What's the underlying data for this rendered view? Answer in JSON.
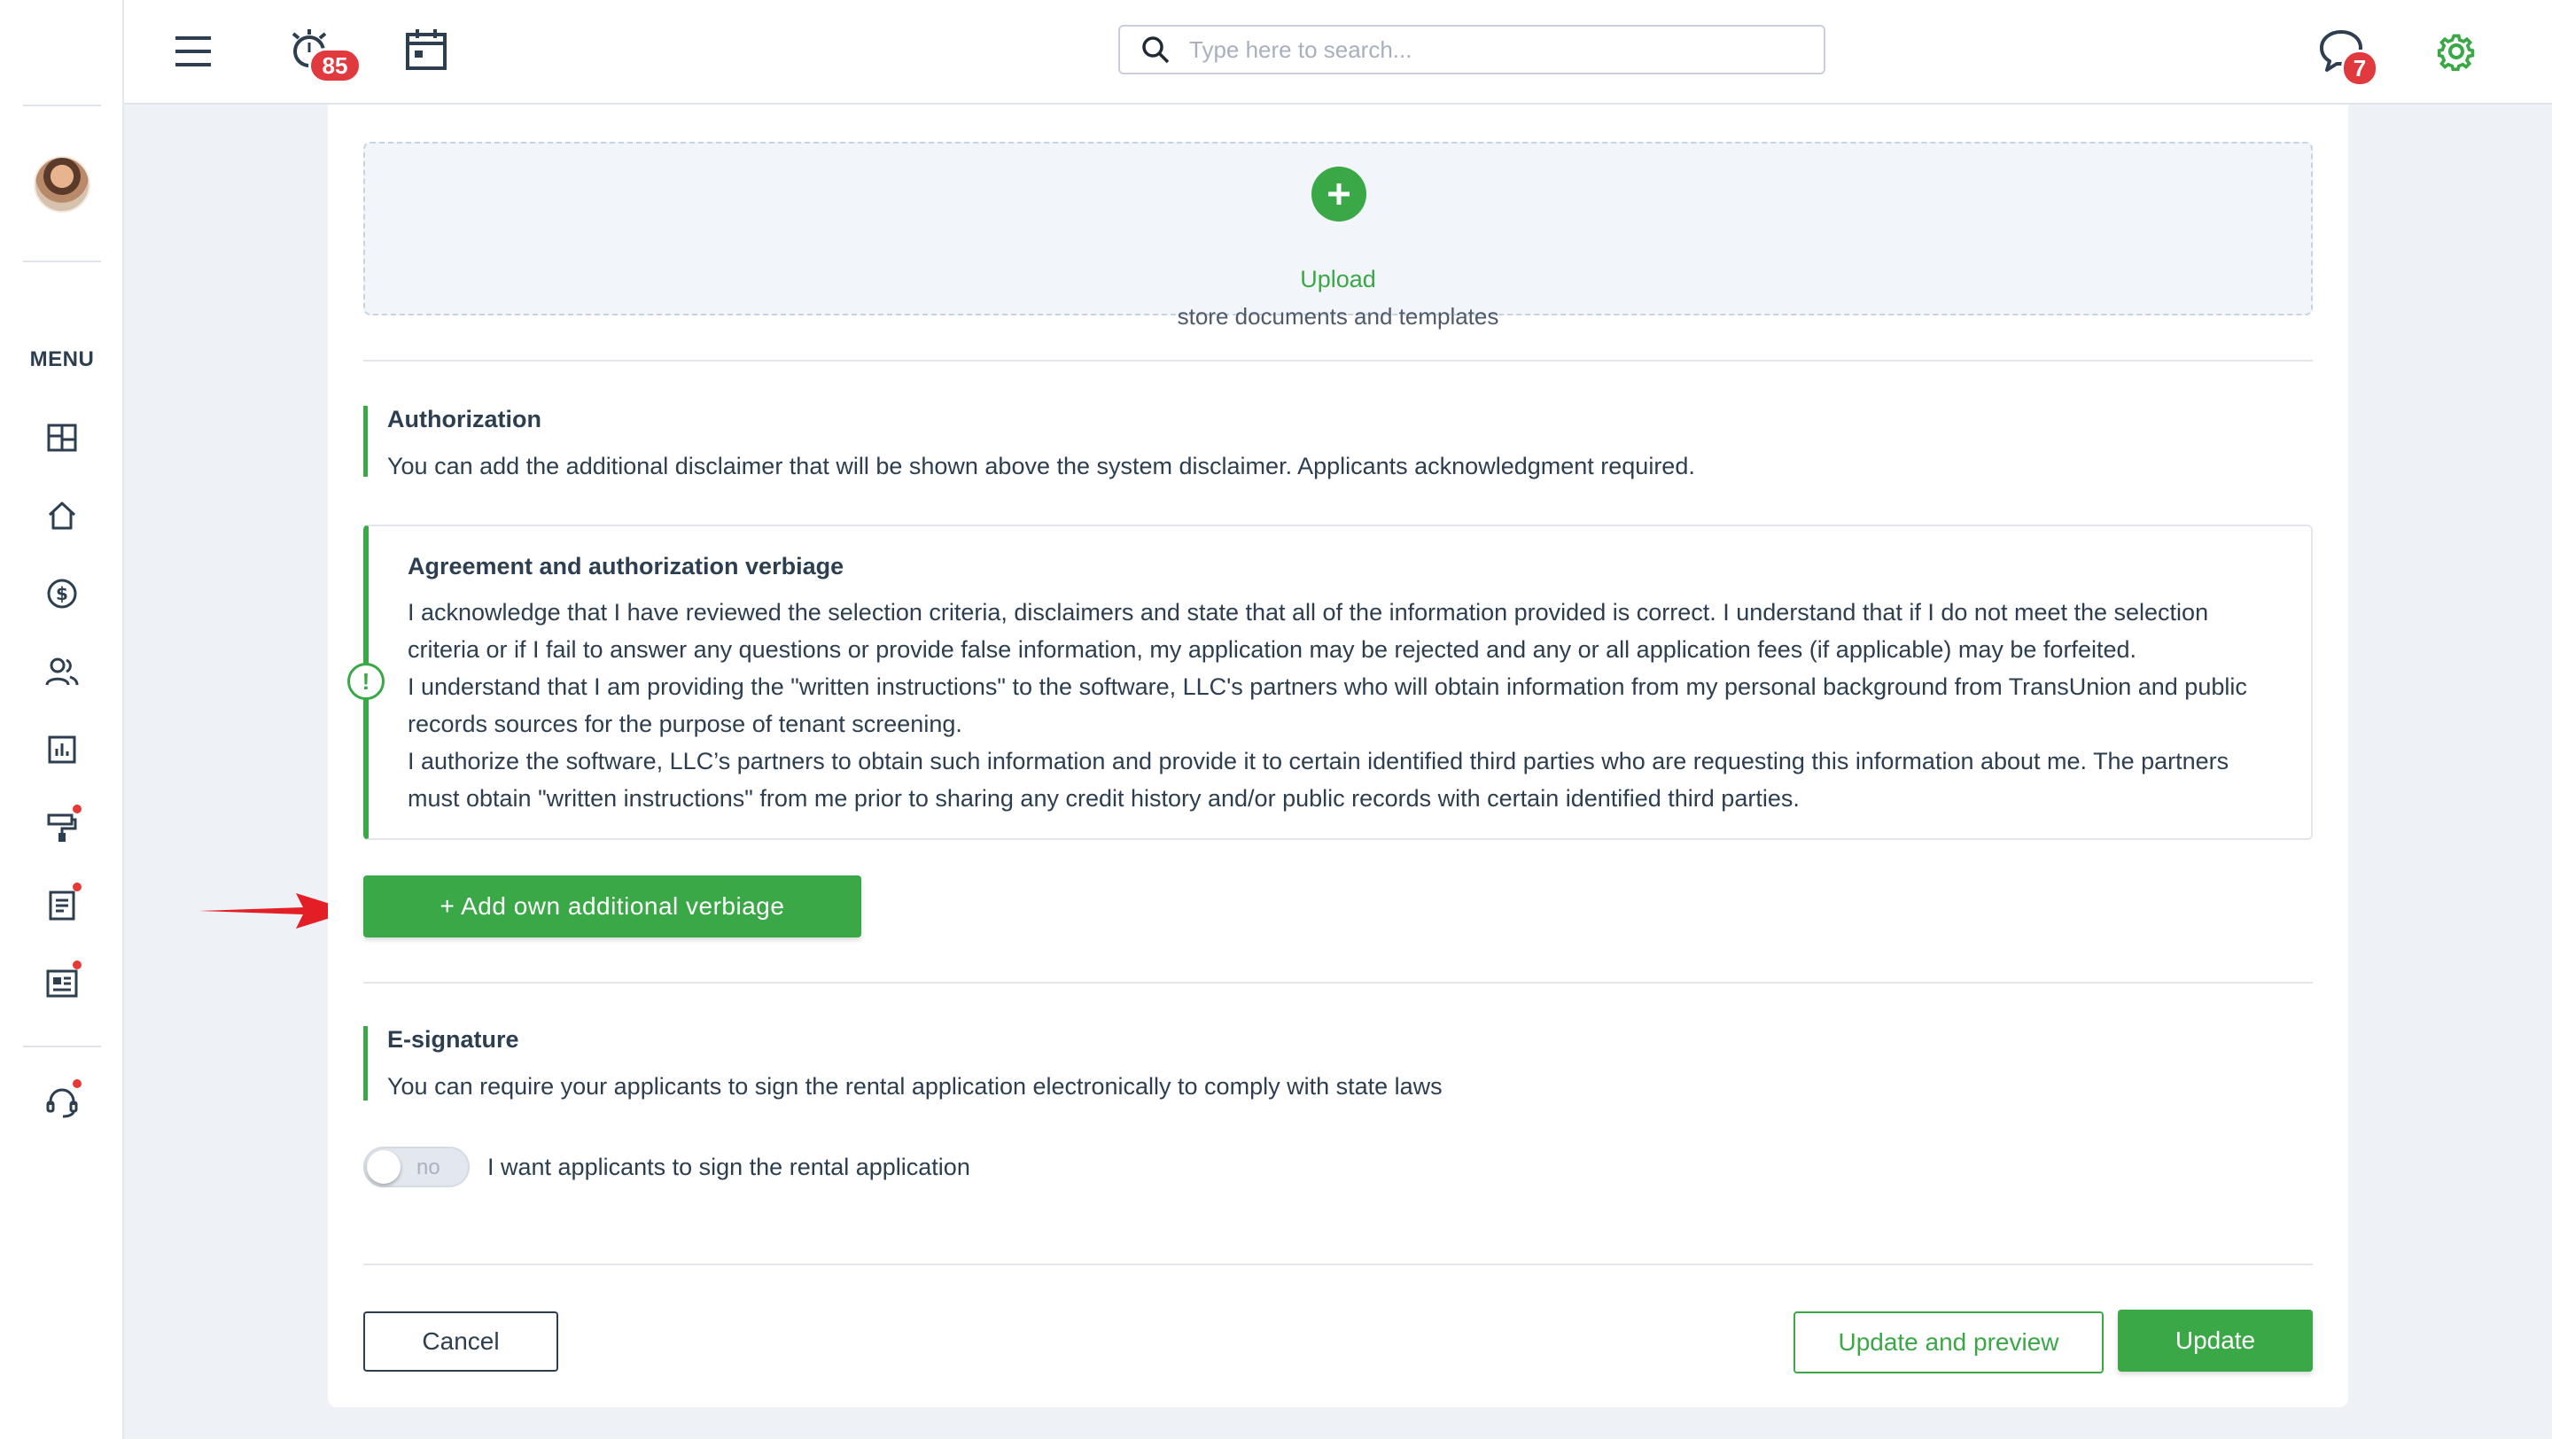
{
  "topbar": {
    "notifications_count": "85",
    "messages_count": "7",
    "search_placeholder": "Type here to search..."
  },
  "sidebar": {
    "menu_label": "MENU",
    "items": [
      {
        "icon": "dashboard-icon",
        "notify": false
      },
      {
        "icon": "home-icon",
        "notify": false
      },
      {
        "icon": "dollar-icon",
        "notify": false
      },
      {
        "icon": "users-icon",
        "notify": false
      },
      {
        "icon": "reports-icon",
        "notify": true
      },
      {
        "icon": "maintenance-icon",
        "notify": true
      },
      {
        "icon": "documents-icon",
        "notify": true
      },
      {
        "icon": "listings-icon",
        "notify": true
      },
      {
        "icon": "support-icon",
        "notify": true
      }
    ]
  },
  "upload": {
    "label": "Upload",
    "sublabel": "store documents and templates"
  },
  "authorization": {
    "title": "Authorization",
    "description": "You can add the additional disclaimer that will be shown above the system disclaimer. Applicants acknowledgment required.",
    "verbiage_title": "Agreement and authorization verbiage",
    "verbiage_paragraphs": [
      "I acknowledge that I have reviewed the selection criteria, disclaimers and state that all of the information provided is correct. I understand that if I do not meet the selection criteria or if I fail to answer any questions or provide false information, my application may be rejected and any or all application fees (if applicable) may be forfeited.",
      "I understand that I am providing the \"written instructions\" to the software, LLC's partners who will obtain information from my personal background from TransUnion and public records sources for the purpose of tenant screening.",
      "I authorize the software, LLC’s partners to obtain such information and provide it to certain identified third parties who are requesting this information about me. The partners must obtain \"written instructions\" from me prior to sharing any credit history and/or public records with certain identified third parties."
    ],
    "add_button": "+ Add own additional verbiage"
  },
  "esignature": {
    "title": "E-signature",
    "description": "You can require your applicants to sign the rental application electronically to comply with state laws",
    "toggle_state": "no",
    "toggle_label": "I want applicants to sign the rental application"
  },
  "actions": {
    "cancel": "Cancel",
    "update_preview": "Update and preview",
    "update": "Update"
  },
  "colors": {
    "accent": "#3aa847",
    "badge": "#e0393e",
    "annotation_arrow": "#e31e24"
  }
}
